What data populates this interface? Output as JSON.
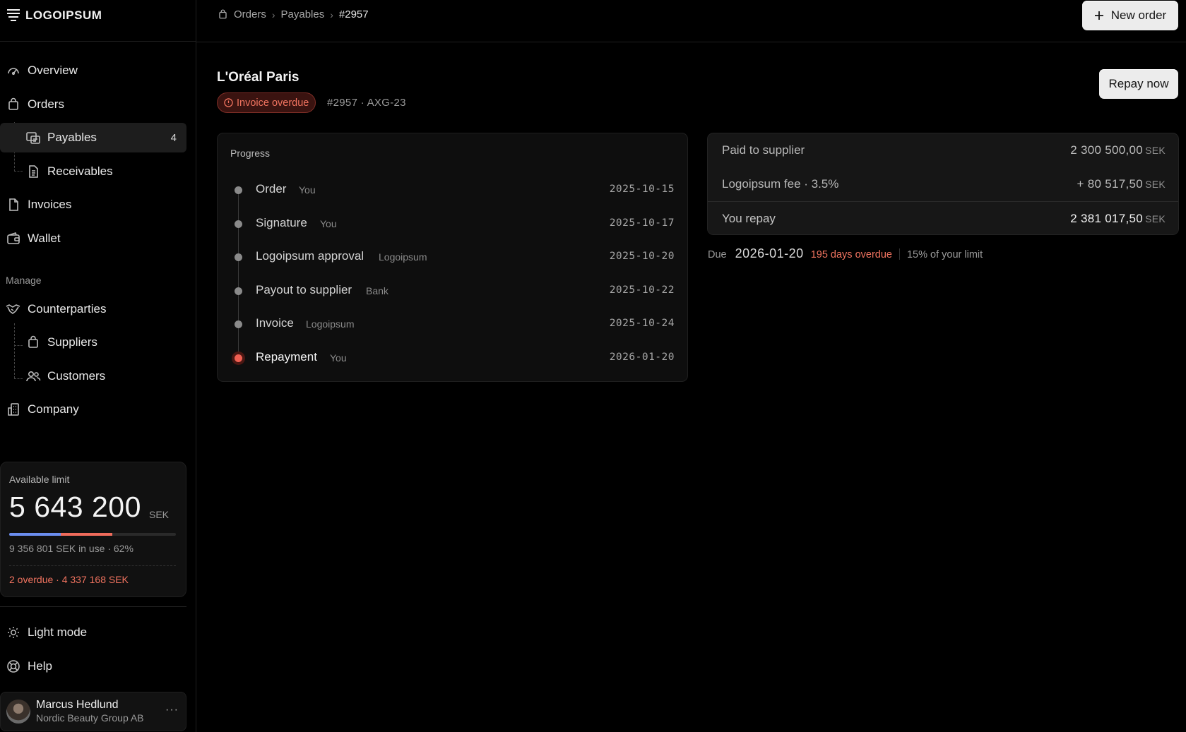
{
  "brand": {
    "name": "LOGOIPSUM"
  },
  "nav": {
    "overview": "Overview",
    "orders": "Orders",
    "payables": "Payables",
    "payables_count": "4",
    "receivables": "Receivables",
    "invoices": "Invoices",
    "wallet": "Wallet",
    "manage_label": "Manage",
    "counterparties": "Counterparties",
    "suppliers": "Suppliers",
    "customers": "Customers",
    "company": "Company",
    "light_mode": "Light mode",
    "help": "Help"
  },
  "limit": {
    "title": "Available limit",
    "value": "5 643 200",
    "currency": "SEK",
    "usage_text": "9 356 801 SEK in use · 62%",
    "usage_bar": {
      "segment_a_percent": 31,
      "segment_b_percent": 31
    },
    "overdue_text": "2 overdue · 4 337 168 SEK"
  },
  "user": {
    "name": "Marcus Hedlund",
    "org": "Nordic Beauty Group AB",
    "more": "···"
  },
  "breadcrumb": {
    "orders": "Orders",
    "payables": "Payables",
    "current": "#2957"
  },
  "actions": {
    "new_order": "New order",
    "repay_now": "Repay now"
  },
  "order": {
    "title": "L'Oréal Paris",
    "status": "Invoice overdue",
    "reference": "#2957 · AXG-23"
  },
  "progress": {
    "label": "Progress",
    "steps": [
      {
        "name": "Order",
        "who": "You",
        "date": "2025-10-15"
      },
      {
        "name": "Signature",
        "who": "You",
        "date": "2025-10-17"
      },
      {
        "name": "Logoipsum approval",
        "who": "Logoipsum",
        "date": "2025-10-20"
      },
      {
        "name": "Payout to supplier",
        "who": "Bank",
        "date": "2025-10-22"
      },
      {
        "name": "Invoice",
        "who": "Logoipsum",
        "date": "2025-10-24"
      },
      {
        "name": "Repayment",
        "who": "You",
        "date": "2026-01-20"
      }
    ]
  },
  "summary": {
    "paid_label": "Paid to supplier",
    "paid_value": "2 300 500,00",
    "fee_label": "Logoipsum fee · 3.5%",
    "fee_value": "+ 80 517,50",
    "repay_label": "You repay",
    "repay_value": "2 381 017,50",
    "currency": "SEK"
  },
  "due": {
    "label": "Due",
    "date": "2026-01-20",
    "overdue": "195 days overdue",
    "limit_share": "15% of your limit"
  },
  "colors": {
    "accent_red": "#f0735f",
    "bar_blue": "#6b8ef0",
    "bar_red": "#ef6b5b"
  }
}
